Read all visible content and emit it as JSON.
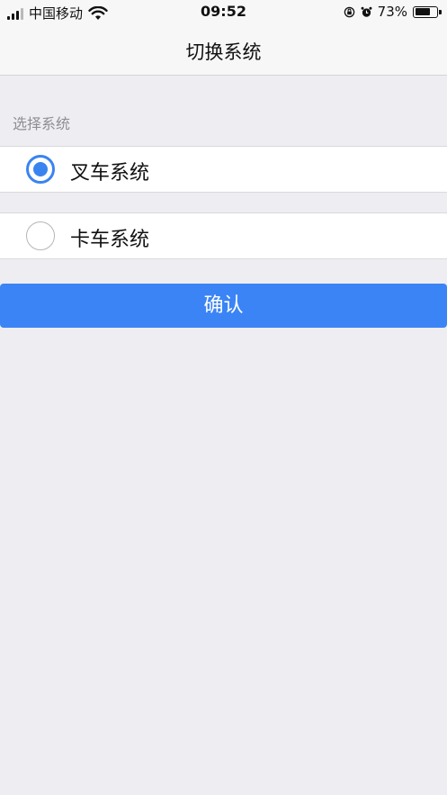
{
  "status_bar": {
    "carrier": "中国移动",
    "time": "09:52",
    "battery_percent": "73%",
    "battery_level": 0.73,
    "icons": [
      "signal-icon",
      "wifi-icon",
      "orientation-lock-icon",
      "alarm-icon",
      "battery-icon"
    ]
  },
  "nav": {
    "title": "切换系统"
  },
  "section": {
    "header": "选择系统"
  },
  "options": [
    {
      "label": "叉车系统",
      "selected": true
    },
    {
      "label": "卡车系统",
      "selected": false
    }
  ],
  "confirm": {
    "label": "确认"
  },
  "colors": {
    "accent": "#3B84F5",
    "background": "#EDEDF2",
    "secondary_text": "#8E8E93"
  }
}
